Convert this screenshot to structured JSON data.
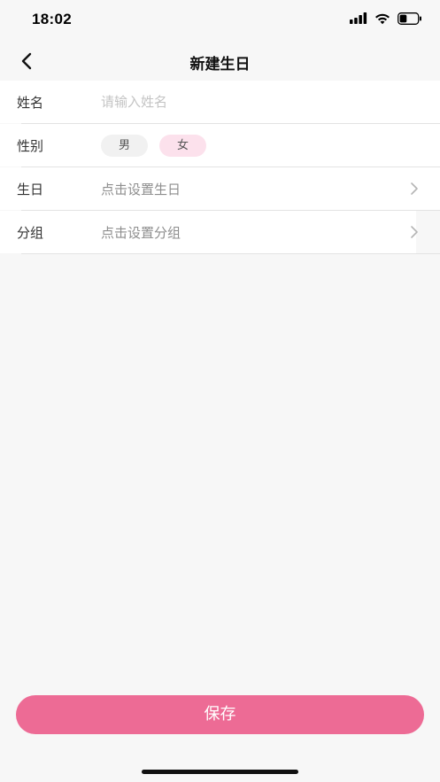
{
  "status_bar": {
    "time": "18:02",
    "battery_level": 0.4
  },
  "nav": {
    "title": "新建生日"
  },
  "form": {
    "name": {
      "label": "姓名",
      "placeholder": "请输入姓名",
      "value": ""
    },
    "gender": {
      "label": "性别",
      "options": [
        "男",
        "女"
      ],
      "selected": "女"
    },
    "birthday": {
      "label": "生日",
      "value": "点击设置生日"
    },
    "group": {
      "label": "分组",
      "value": "点击设置分组"
    }
  },
  "actions": {
    "save_label": "保存"
  },
  "colors": {
    "accent": "#ed6b95",
    "selected_chip": "#fce1ec",
    "background": "#f7f7f7"
  },
  "icons": {
    "back": "chevron-left-icon",
    "disclosure": "chevron-right-icon",
    "signal": "cellular-signal-icon",
    "wifi": "wifi-icon",
    "battery": "battery-icon"
  }
}
